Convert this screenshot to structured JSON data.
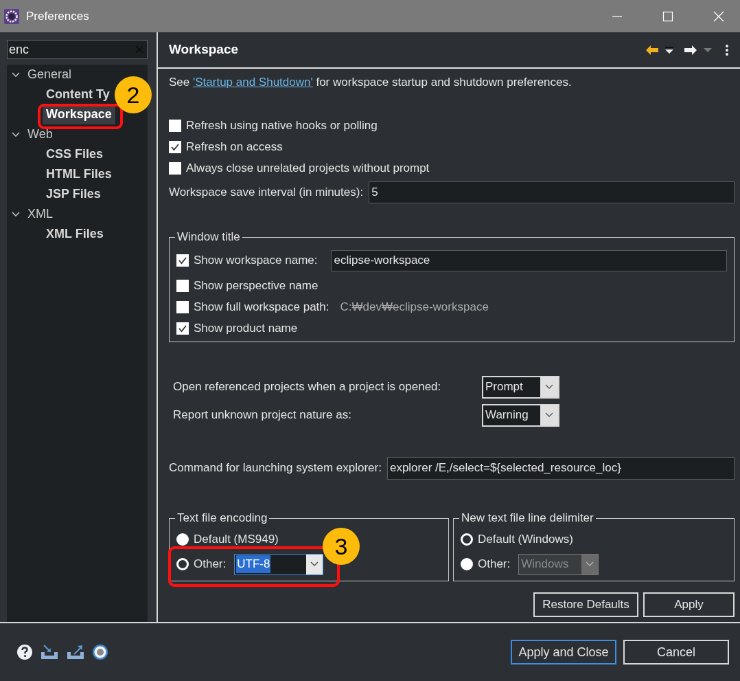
{
  "window": {
    "title": "Preferences"
  },
  "filter": {
    "value": "enc"
  },
  "tree": [
    {
      "label": "General",
      "expanded": true,
      "children": [
        {
          "label": "Content Ty",
          "selected": false
        },
        {
          "label": "Workspace",
          "selected": true
        }
      ]
    },
    {
      "label": "Web",
      "expanded": true,
      "children": [
        {
          "label": "CSS Files",
          "selected": false
        },
        {
          "label": "HTML Files",
          "selected": false
        },
        {
          "label": "JSP Files",
          "selected": false
        }
      ]
    },
    {
      "label": "XML",
      "expanded": true,
      "children": [
        {
          "label": "XML Files",
          "selected": false
        }
      ]
    }
  ],
  "page": {
    "title": "Workspace",
    "intro": {
      "before": "See ",
      "link": "'Startup and Shutdown'",
      "after": " for workspace startup and shutdown preferences."
    },
    "options": [
      {
        "label": "Refresh using native hooks or polling",
        "checked": false
      },
      {
        "label": "Refresh on access",
        "checked": true
      },
      {
        "label": "Always close unrelated projects without prompt",
        "checked": false
      }
    ],
    "save_interval": {
      "label": "Workspace save interval (in minutes):",
      "value": "5"
    },
    "window_title": {
      "legend": "Window title",
      "items": [
        {
          "kind": "field",
          "label": "Show workspace name:",
          "checked": true,
          "value": "eclipse-workspace"
        },
        {
          "kind": "plain",
          "label": "Show perspective name",
          "checked": false
        },
        {
          "kind": "path",
          "label": "Show full workspace path:",
          "checked": false,
          "value": "C:₩dev₩eclipse-workspace"
        },
        {
          "kind": "plain",
          "label": "Show product name",
          "checked": true
        }
      ]
    },
    "combos": [
      {
        "label": "Open referenced projects when a project is opened:",
        "value": "Prompt"
      },
      {
        "label": "Report unknown project nature as:",
        "value": "Warning"
      }
    ],
    "explorer_command": {
      "label": "Command for launching system explorer:",
      "value": "explorer /E,/select=${selected_resource_loc}"
    },
    "encoding": {
      "legend": "Text file encoding",
      "options": [
        {
          "label": "Default (MS949)",
          "selected": false
        },
        {
          "label": "Other:",
          "selected": true,
          "value": "UTF-8"
        }
      ]
    },
    "delimiter": {
      "legend": "New text file line delimiter",
      "options": [
        {
          "label": "Default (Windows)",
          "selected": true
        },
        {
          "label": "Other:",
          "selected": false,
          "value": "Windows"
        }
      ]
    },
    "buttons": [
      "Restore Defaults",
      "Apply"
    ]
  },
  "footer": {
    "buttons": [
      {
        "label": "Apply and Close",
        "default": true
      },
      {
        "label": "Cancel",
        "default": false
      }
    ]
  },
  "callouts": [
    {
      "number": "2"
    },
    {
      "number": "3"
    }
  ]
}
